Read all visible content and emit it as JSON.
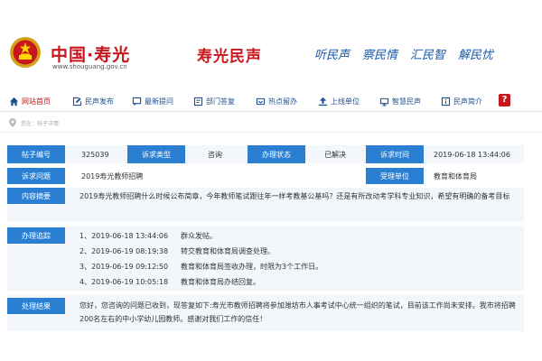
{
  "header": {
    "site_name": "中国·寿光",
    "site_url": "www.shouguang.gov.cn",
    "app_title": "寿光民声",
    "slogans": [
      "听民声",
      "察民情",
      "汇民智",
      "解民忧"
    ]
  },
  "nav": {
    "items": [
      {
        "label": "网站首页",
        "icon": "home-icon"
      },
      {
        "label": "民声发布",
        "icon": "edit-icon"
      },
      {
        "label": "最新提问",
        "icon": "question-icon"
      },
      {
        "label": "部门答复",
        "icon": "reply-icon"
      },
      {
        "label": "热点留办",
        "icon": "hot-icon"
      },
      {
        "label": "上线单位",
        "icon": "upload-icon"
      },
      {
        "label": "智慧民声",
        "icon": "smart-icon"
      },
      {
        "label": "民声简介",
        "icon": "info-icon"
      }
    ],
    "help": "?"
  },
  "location": "您在：帖子详情",
  "post": {
    "labels": {
      "id": "帖子编号",
      "type": "诉求类型",
      "status": "办理状态",
      "time": "诉求时间",
      "subject": "诉求问题",
      "dept": "受理单位",
      "content": "内容摘要",
      "progress": "办理追踪",
      "result": "处理结果"
    },
    "id": "325039",
    "type": "咨询",
    "status": "已解决",
    "time": "2019-06-18 13:44:06",
    "subject": "2019寿光教师招聘",
    "dept": "教育和体育局",
    "content": "2019寿光教师招聘什么时候公布简章，今年教师笔试跟往年一样考教基公基吗？还是有所改动考学科专业知识，希望有明确的备考目标",
    "progress": [
      {
        "time": "1、2019-06-18 13:44:06",
        "text": "群众发帖。"
      },
      {
        "time": "2、2019-06-19 08:19:38",
        "text": "转交教育和体育局调查处理。"
      },
      {
        "time": "3、2019-06-19 09:12:50",
        "text": "教育和体育局签收办理，时限为3个工作日。"
      },
      {
        "time": "4、2019-06-19 10:05:18",
        "text": "教育和体育局办结回复。"
      }
    ],
    "result": "您好，您咨询的问题已收到，现答复如下:寿光市教师招聘将参加潍坊市人事考试中心统一组织的笔试，目前该工作尚未安排。我市将招聘200名左右的中小学幼儿园教师。感谢对我们工作的信任！"
  },
  "colors": {
    "brand_red": "#c8161d",
    "label_blue": "#2b7fd3",
    "slogan_blue": "#1a5aa8"
  }
}
